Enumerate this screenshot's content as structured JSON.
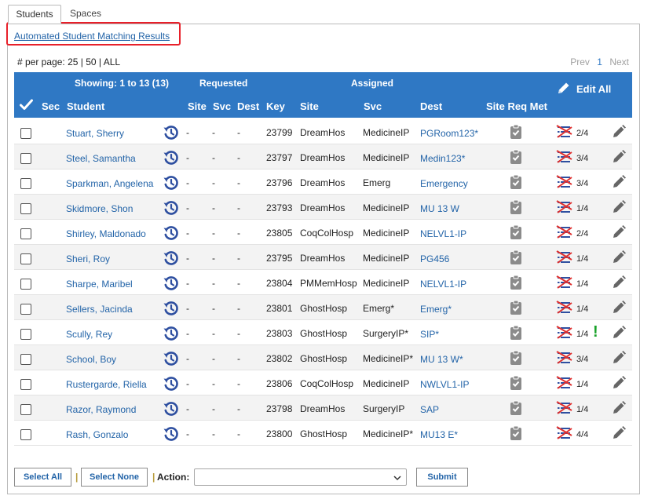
{
  "tabs": [
    {
      "label": "Students",
      "active": true
    },
    {
      "label": "Spaces",
      "active": false
    }
  ],
  "match_link": "Automated Student Matching Results",
  "per_page": {
    "label": "# per page:",
    "options": [
      "25",
      "50",
      "ALL"
    ]
  },
  "pager": {
    "prev": "Prev",
    "current": "1",
    "next": "Next"
  },
  "header": {
    "showing": "Showing: 1 to 13 (13)",
    "requested": "Requested",
    "assigned": "Assigned",
    "edit_all": "Edit All",
    "cols": {
      "sec": "Sec",
      "student": "Student",
      "site": "Site",
      "svc": "Svc",
      "dest": "Dest",
      "key": "Key",
      "asite": "Site",
      "asvc": "Svc",
      "adest": "Dest",
      "site_req_met": "Site Req Met"
    }
  },
  "rows": [
    {
      "student": "Stuart, Sherry",
      "rsite": "-",
      "rsvc": "-",
      "rdest": "-",
      "key": "23799",
      "site": "DreamHos",
      "svc": "MedicineIP",
      "dest": "PGRoom123*",
      "req": "2/4"
    },
    {
      "student": "Steel, Samantha",
      "rsite": "-",
      "rsvc": "-",
      "rdest": "-",
      "key": "23797",
      "site": "DreamHos",
      "svc": "MedicineIP",
      "dest": "Medin123*",
      "req": "3/4"
    },
    {
      "student": "Sparkman, Angelena",
      "rsite": "-",
      "rsvc": "-",
      "rdest": "-",
      "key": "23796",
      "site": "DreamHos",
      "svc": "Emerg",
      "dest": "Emergency",
      "req": "3/4"
    },
    {
      "student": "Skidmore, Shon",
      "rsite": "-",
      "rsvc": "-",
      "rdest": "-",
      "key": "23793",
      "site": "DreamHos",
      "svc": "MedicineIP",
      "dest": "MU 13 W",
      "req": "1/4"
    },
    {
      "student": "Shirley, Maldonado",
      "rsite": "-",
      "rsvc": "-",
      "rdest": "-",
      "key": "23805",
      "site": "CoqColHosp",
      "svc": "MedicineIP",
      "dest": "NELVL1-IP",
      "req": "2/4"
    },
    {
      "student": "Sheri, Roy",
      "rsite": "-",
      "rsvc": "-",
      "rdest": "-",
      "key": "23795",
      "site": "DreamHos",
      "svc": "MedicineIP",
      "dest": "PG456",
      "req": "1/4"
    },
    {
      "student": "Sharpe, Maribel",
      "rsite": "-",
      "rsvc": "-",
      "rdest": "-",
      "key": "23804",
      "site": "PMMemHosp",
      "svc": "MedicineIP",
      "dest": "NELVL1-IP",
      "req": "1/4"
    },
    {
      "student": "Sellers, Jacinda",
      "rsite": "-",
      "rsvc": "-",
      "rdest": "-",
      "key": "23801",
      "site": "GhostHosp",
      "svc": "Emerg*",
      "dest": "Emerg*",
      "req": "1/4"
    },
    {
      "student": "Scully, Rey",
      "rsite": "-",
      "rsvc": "-",
      "rdest": "-",
      "key": "23803",
      "site": "GhostHosp",
      "svc": "SurgeryIP*",
      "dest": "SIP*",
      "req": "1/4",
      "warn": "!"
    },
    {
      "student": "School, Boy",
      "rsite": "-",
      "rsvc": "-",
      "rdest": "-",
      "key": "23802",
      "site": "GhostHosp",
      "svc": "MedicineIP*",
      "dest": "MU 13 W*",
      "req": "3/4"
    },
    {
      "student": "Rustergarde, Riella",
      "rsite": "-",
      "rsvc": "-",
      "rdest": "-",
      "key": "23806",
      "site": "CoqColHosp",
      "svc": "MedicineIP",
      "dest": "NWLVL1-IP",
      "req": "1/4"
    },
    {
      "student": "Razor, Raymond",
      "rsite": "-",
      "rsvc": "-",
      "rdest": "-",
      "key": "23798",
      "site": "DreamHos",
      "svc": "SurgeryIP",
      "dest": "SAP",
      "req": "1/4"
    },
    {
      "student": "Rash, Gonzalo",
      "rsite": "-",
      "rsvc": "-",
      "rdest": "-",
      "key": "23800",
      "site": "GhostHosp",
      "svc": "MedicineIP*",
      "dest": "MU13 E*",
      "req": "4/4"
    }
  ],
  "footer": {
    "select_all": "Select All",
    "select_none": "Select None",
    "sep": "|",
    "action_label": "Action:",
    "action_value": "",
    "submit": "Submit"
  },
  "colors": {
    "header": "#2f78c4",
    "link": "#2364a8",
    "highlight_box": "#e8202a",
    "warning": "#19a22a",
    "history_icon": "#2e4fa0"
  },
  "icons": [
    "check-icon",
    "pencil-icon",
    "history-icon",
    "clipboard-check-icon",
    "requirements-list-icon",
    "warning-icon",
    "chevron-down-icon"
  ]
}
